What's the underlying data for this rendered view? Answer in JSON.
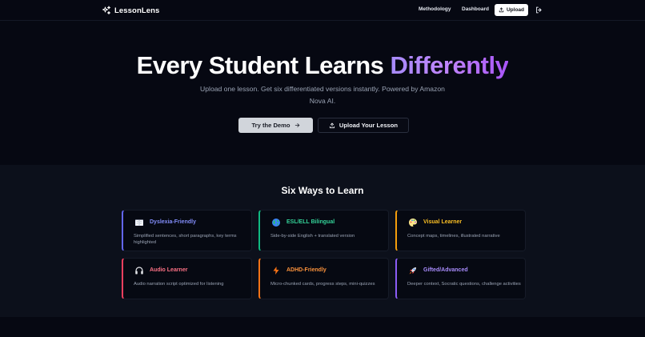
{
  "nav": {
    "brand": "LessonLens",
    "links": [
      "Methodology",
      "Dashboard"
    ],
    "upload_label": "Upload",
    "icons": {
      "brand": "sparkles-icon",
      "upload": "upload-icon",
      "logout": "logout-icon"
    }
  },
  "hero": {
    "title_main": "Every Student Learns ",
    "title_accent": "Differently",
    "subtitle": "Upload one lesson. Get six differentiated versions instantly. Powered by Amazon Nova AI.",
    "cta_primary": "Try the Demo",
    "cta_secondary": "Upload Your Lesson"
  },
  "section": {
    "title": "Six Ways to Learn",
    "cards": [
      {
        "title": "Dyslexia-Friendly",
        "description": "Simplified sentences, short paragraphs, key terms highlighted",
        "icon": "book-icon",
        "accent": "#6366f1",
        "title_color": "#818cf8"
      },
      {
        "title": "ESL/ELL Bilingual",
        "description": "Side-by-side English + translated version",
        "icon": "globe-icon",
        "accent": "#10b981",
        "title_color": "#34d399"
      },
      {
        "title": "Visual Learner",
        "description": "Concept maps, timelines, illustrated narrative",
        "icon": "palette-icon",
        "accent": "#f59e0b",
        "title_color": "#fbbf24"
      },
      {
        "title": "Audio Learner",
        "description": "Audio narration script optimized for listening",
        "icon": "headphones-icon",
        "accent": "#f43f5e",
        "title_color": "#fb7185"
      },
      {
        "title": "ADHD-Friendly",
        "description": "Micro-chunked cards, progress steps, mini-quizzes",
        "icon": "lightning-icon",
        "accent": "#f97316",
        "title_color": "#fb923c"
      },
      {
        "title": "Gifted/Advanced",
        "description": "Deeper context, Socratic questions, challenge activities",
        "icon": "rocket-icon",
        "accent": "#8b5cf6",
        "title_color": "#a78bfa"
      }
    ]
  }
}
